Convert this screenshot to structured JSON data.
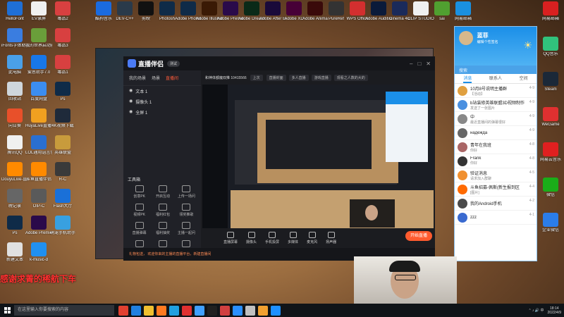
{
  "desktop": {
    "left_icons": [
      {
        "label": "HelloFont",
        "color": "#1f6fd6"
      },
      {
        "label": "EV录屏",
        "color": "#f0f0f0"
      },
      {
        "label": "毒品2",
        "color": "#d84040"
      },
      {
        "label": "iFonts字体助手",
        "color": "#3a7de0"
      },
      {
        "label": "我的世界启动器",
        "color": "#6a9e3a"
      },
      {
        "label": "毒品3",
        "color": "#d84040"
      },
      {
        "label": "此电脑",
        "color": "#4aa0e8"
      },
      {
        "label": "爱思助手7.0",
        "color": "#1877e8"
      },
      {
        "label": "毒品1",
        "color": "#d84040"
      },
      {
        "label": "回收站",
        "color": "#cfd6dc"
      },
      {
        "label": "百度网盘",
        "color": "#3b8df0"
      },
      {
        "label": "Ps",
        "color": "#0f2b48"
      },
      {
        "label": "向日葵",
        "color": "#e8502a"
      },
      {
        "label": "HuyaLive直播伴侣",
        "color": "#f0a020"
      },
      {
        "label": "4K视频下载",
        "color": "#1f2a3a"
      },
      {
        "label": "腾讯QQ",
        "color": "#f0f0f0"
      },
      {
        "label": "LOL通用语言包",
        "color": "#2a6fd0"
      },
      {
        "label": "英雄联盟",
        "color": "#c89b3c"
      },
      {
        "label": "DouyuLive-直播伴侣",
        "color": "#ff8a00"
      },
      {
        "label": "斗鱼直播伴侣",
        "color": "#ff8a00"
      },
      {
        "label": "R-C",
        "color": "#3a3a3a"
      },
      {
        "label": "晚记录",
        "color": "#666666"
      },
      {
        "label": "OIP-C",
        "color": "#5a5a5a"
      },
      {
        "label": "Flash大厅",
        "color": "#1a70d8"
      },
      {
        "label": "Ps",
        "color": "#0f2b48"
      },
      {
        "label": "Adobe Premiere",
        "color": "#2a0a4a"
      },
      {
        "label": "萌宠手机助手",
        "color": "#38a0e0"
      },
      {
        "label": "新建文本",
        "color": "#e0e0e0"
      },
      {
        "label": "k-music-d",
        "color": "#2090f0"
      }
    ],
    "top_icons": [
      {
        "label": "酷狗音乐",
        "color": "#1a6be0"
      },
      {
        "label": "DEV-C++",
        "color": "#2a3a4a"
      },
      {
        "label": "剪映",
        "color": "#111111"
      },
      {
        "label": "Photosh",
        "color": "#0f2b48"
      },
      {
        "label": "Adobe Photosh",
        "color": "#0f2b48"
      },
      {
        "label": "Adobe Illustrat",
        "color": "#3a1a05"
      },
      {
        "label": "Adobe Premie",
        "color": "#2a0a4a"
      },
      {
        "label": "Adobe Dreamwe",
        "color": "#0a2a18"
      },
      {
        "label": "Adobe After Effects 2020",
        "color": "#1a0a3a"
      },
      {
        "label": "Adobe XD",
        "color": "#470137"
      },
      {
        "label": "Adobe Anima",
        "color": "#3a0a0a"
      },
      {
        "label": "PureRef",
        "color": "#333333"
      },
      {
        "label": "WPS Office",
        "color": "#d32f2f"
      },
      {
        "label": "Adobe Audition",
        "color": "#0a1a3a"
      },
      {
        "label": "Cinema 4D",
        "color": "#1a2a5a"
      },
      {
        "label": "CLIP STUDIO",
        "color": "#f0f0f0"
      },
      {
        "label": "sai",
        "color": "#50a030"
      },
      {
        "label": "网易邮箱",
        "color": "#1a90e0"
      }
    ],
    "right_icons": [
      {
        "label": "网易邮箱",
        "color": "#d82020"
      },
      {
        "label": "QQ音乐",
        "color": "#31c27c"
      },
      {
        "label": "Steam",
        "color": "#1b2838"
      },
      {
        "label": "WeGame",
        "color": "#e03030"
      },
      {
        "label": "网易云音乐",
        "color": "#e02020"
      },
      {
        "label": "微信",
        "color": "#1aad19"
      },
      {
        "label": "企业微信",
        "color": "#2b7de9"
      }
    ],
    "banner": "感谢求菁的稀航下车"
  },
  "live": {
    "app_name": "直播伴侣",
    "chip": "测试",
    "tabs": [
      "我的场景",
      "场景",
      "直播间"
    ],
    "active_tab": 2,
    "sources": [
      {
        "label": "文本 1"
      },
      {
        "label": "摄像头 1"
      },
      {
        "label": "全屏 1"
      }
    ],
    "room_title": "和神体都魔双推 10415566",
    "room_btn": "上次",
    "room_id": "10415566",
    "top_pills": [
      "直播封面",
      "多人直播",
      "游戏直播",
      "观看之人数的大的"
    ],
    "tools_title": "工具箱",
    "tools": [
      "创意PK",
      "开启互动",
      "上传一场问",
      "视频PK",
      "福利红包",
      "领奖推歌",
      "直播弹幕",
      "福利抽奖",
      "主播一起问",
      "连麦PK",
      "小游戏",
      "商业技能"
    ],
    "bottom": [
      "直播屏幕",
      "摄像头",
      "手机投屏",
      "多媒体",
      "麦克风",
      "扬声器"
    ],
    "golive": "开始直播",
    "status": "礼物包送， 欢迎你来的主播的直播平台，新建直播间"
  },
  "qq": {
    "user": "蓝菲",
    "sign": "编辑个性签名",
    "search": "搜索",
    "tabs": [
      "消息",
      "联系人",
      "空间"
    ],
    "chats": [
      {
        "name": "10月8号说明主播群",
        "preview": "【活动】",
        "time": "4-9",
        "color": "#e0a040"
      },
      {
        "name": "b站装修英雄联盟3D视频制作",
        "preview": "发送了一张图片",
        "time": "4-9",
        "color": "#4a90e0"
      },
      {
        "name": "中",
        "preview": "最近直播间的弹幕很好",
        "time": "4-9",
        "color": "#888888"
      },
      {
        "name": "надежда",
        "preview": "",
        "time": "4-9",
        "color": "#666666"
      },
      {
        "name": "青年在我班",
        "preview": "你好",
        "time": "4-8",
        "color": "#aa6666"
      },
      {
        "name": "Frank",
        "preview": "你好",
        "time": "4-8",
        "color": "#333333"
      },
      {
        "name": "验证消息",
        "preview": "请求加入群聊",
        "time": "4-5",
        "color": "#f09030"
      },
      {
        "name": "斗鱼招募-佩斯(新生报到区",
        "preview": "[图片]",
        "time": "4-4",
        "color": "#ff6a00"
      },
      {
        "name": "我的Android手机",
        "preview": "",
        "time": "4-2",
        "color": "#4a4a4a"
      },
      {
        "name": "zzz",
        "preview": "",
        "time": "4-1",
        "color": "#3a6ad0"
      }
    ]
  },
  "taskbar": {
    "search_placeholder": "在这里输入你要搜索的内容",
    "apps": [
      "#e04030",
      "#2080e0",
      "#f0c030",
      "#ff7a20",
      "#20a0e0",
      "#e03030",
      "#40a0ff",
      "#202020",
      "#d04040",
      "#2a90ff",
      "#c0c0c0",
      "#f0a030",
      "#1e90ff"
    ],
    "time": "18:14",
    "date": "2022/4/9"
  }
}
